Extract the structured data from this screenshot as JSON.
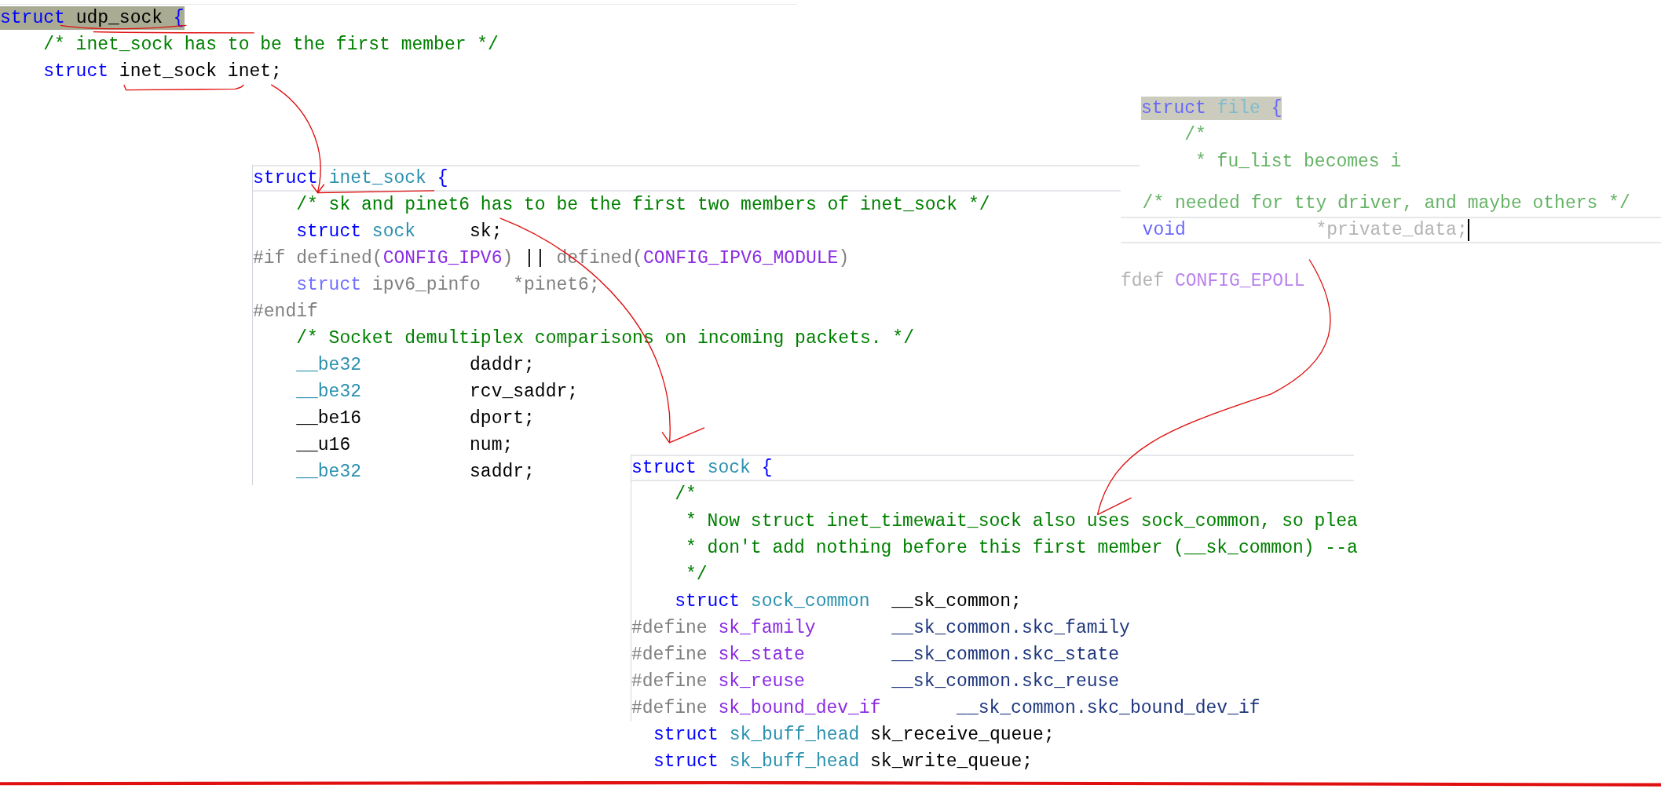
{
  "fragments": [
    {
      "faded": false,
      "lines": [
        {
          "highlight": true,
          "tokens": [
            {
              "kind": "kw",
              "text": "struct"
            },
            {
              "kind": "plain",
              "text": " udp_sock "
            },
            {
              "kind": "kw",
              "text": "{"
            }
          ]
        },
        {
          "tokens": [
            {
              "kind": "comment",
              "text": "    /* inet_sock has to be the first member */"
            }
          ]
        },
        {
          "tokens": [
            {
              "kind": "kw",
              "text": "    struct"
            },
            {
              "kind": "plain",
              "text": " inet_sock inet;"
            }
          ]
        }
      ]
    },
    {
      "faded": false,
      "lines": [
        {
          "framed": true,
          "tokens": [
            {
              "kind": "kw",
              "text": "struct"
            },
            {
              "kind": "type",
              "text": " inet_sock"
            },
            {
              "kind": "kw",
              "text": " {"
            }
          ]
        },
        {
          "tokens": [
            {
              "kind": "comment",
              "text": "    /* sk and pinet6 has to be the first two members of inet_sock */"
            }
          ]
        },
        {
          "tokens": [
            {
              "kind": "kw",
              "text": "    struct"
            },
            {
              "kind": "type",
              "text": " sock"
            },
            {
              "kind": "plain",
              "text": "     sk;"
            }
          ]
        },
        {
          "tokens": [
            {
              "kind": "pre",
              "text": "#if defined("
            },
            {
              "kind": "macro",
              "text": "CONFIG_IPV6"
            },
            {
              "kind": "pre",
              "text": ") "
            },
            {
              "kind": "plain",
              "text": "||"
            },
            {
              "kind": "pre",
              "text": " defined("
            },
            {
              "kind": "macro",
              "text": "CONFIG_IPV6_MODULE"
            },
            {
              "kind": "pre",
              "text": ")"
            }
          ]
        },
        {
          "tokens": [
            {
              "kind": "dimkw",
              "text": "    struct"
            },
            {
              "kind": "dim",
              "text": " ipv6_pinfo   *pinet6;"
            }
          ]
        },
        {
          "tokens": [
            {
              "kind": "pre",
              "text": "#endif"
            }
          ]
        },
        {
          "tokens": [
            {
              "kind": "comment",
              "text": "    /* Socket demultiplex comparisons on incoming packets. */"
            }
          ]
        },
        {
          "tokens": [
            {
              "kind": "type",
              "text": "    __be32"
            },
            {
              "kind": "plain",
              "text": "          daddr;"
            }
          ]
        },
        {
          "tokens": [
            {
              "kind": "type",
              "text": "    __be32"
            },
            {
              "kind": "plain",
              "text": "          rcv_saddr;"
            }
          ]
        },
        {
          "tokens": [
            {
              "kind": "plain",
              "text": "    __be16          dport;"
            }
          ]
        },
        {
          "tokens": [
            {
              "kind": "plain",
              "text": "    __u16           num;"
            }
          ]
        },
        {
          "tokens": [
            {
              "kind": "type",
              "text": "    __be32"
            },
            {
              "kind": "plain",
              "text": "          saddr;"
            }
          ]
        }
      ]
    },
    {
      "faded": true,
      "lines": [
        {
          "highlight": true,
          "tokens": [
            {
              "kind": "kw",
              "text": "struct"
            },
            {
              "kind": "type",
              "text": " file"
            },
            {
              "kind": "kw",
              "text": " {"
            }
          ]
        },
        {
          "tokens": [
            {
              "kind": "comment",
              "text": "    /*"
            }
          ]
        },
        {
          "tokens": [
            {
              "kind": "comment",
              "text": "     * fu_list becomes i"
            }
          ]
        }
      ]
    },
    {
      "faded": true,
      "lines": [
        {
          "tokens": [
            {
              "kind": "comment",
              "text": "  /* needed for tty driver, and maybe others */"
            }
          ]
        },
        {
          "framed": true,
          "cursor": true,
          "tokens": [
            {
              "kind": "kw",
              "text": "  void"
            },
            {
              "kind": "dim",
              "text": "            *private_data;"
            }
          ]
        }
      ]
    },
    {
      "faded": true,
      "lines": [
        {
          "tokens": [
            {
              "kind": "pre",
              "text": "fdef "
            },
            {
              "kind": "macro",
              "text": "CONFIG_EPOLL"
            }
          ]
        }
      ]
    },
    {
      "faded": false,
      "lines": [
        {
          "framed": true,
          "tokens": [
            {
              "kind": "kw",
              "text": "struct"
            },
            {
              "kind": "type",
              "text": " sock"
            },
            {
              "kind": "kw",
              "text": " {"
            }
          ]
        },
        {
          "tokens": [
            {
              "kind": "comment",
              "text": "    /*"
            }
          ]
        },
        {
          "tokens": [
            {
              "kind": "comment",
              "text": "     * Now struct inet_timewait_sock also uses sock_common, so plea"
            }
          ]
        },
        {
          "tokens": [
            {
              "kind": "comment",
              "text": "     * don't add nothing before this first member (__sk_common) --a"
            }
          ]
        },
        {
          "tokens": [
            {
              "kind": "comment",
              "text": "     */"
            }
          ]
        },
        {
          "tokens": [
            {
              "kind": "kw",
              "text": "    struct"
            },
            {
              "kind": "type",
              "text": " sock_common"
            },
            {
              "kind": "plain",
              "text": "  __sk_common;"
            }
          ]
        },
        {
          "tokens": [
            {
              "kind": "pre",
              "text": "#define "
            },
            {
              "kind": "macro",
              "text": "sk_family"
            },
            {
              "kind": "member",
              "text": "       __sk_common.skc_family"
            }
          ]
        },
        {
          "tokens": [
            {
              "kind": "pre",
              "text": "#define "
            },
            {
              "kind": "macro",
              "text": "sk_state"
            },
            {
              "kind": "member",
              "text": "        __sk_common.skc_state"
            }
          ]
        },
        {
          "tokens": [
            {
              "kind": "pre",
              "text": "#define "
            },
            {
              "kind": "macro",
              "text": "sk_reuse"
            },
            {
              "kind": "member",
              "text": "        __sk_common.skc_reuse"
            }
          ]
        },
        {
          "tokens": [
            {
              "kind": "pre",
              "text": "#define "
            },
            {
              "kind": "macro",
              "text": "sk_bound_dev_if"
            },
            {
              "kind": "member",
              "text": "       __sk_common.skc_bound_dev_if"
            }
          ]
        }
      ]
    },
    {
      "faded": false,
      "lines": [
        {
          "tokens": [
            {
              "kind": "kw",
              "text": "struct"
            },
            {
              "kind": "type",
              "text": " sk_buff_head"
            },
            {
              "kind": "plain",
              "text": " sk_receive_queue;"
            }
          ]
        },
        {
          "tokens": [
            {
              "kind": "kw",
              "text": "struct"
            },
            {
              "kind": "type",
              "text": " sk_buff_head"
            },
            {
              "kind": "plain",
              "text": " sk_write_queue;"
            }
          ]
        }
      ]
    }
  ]
}
